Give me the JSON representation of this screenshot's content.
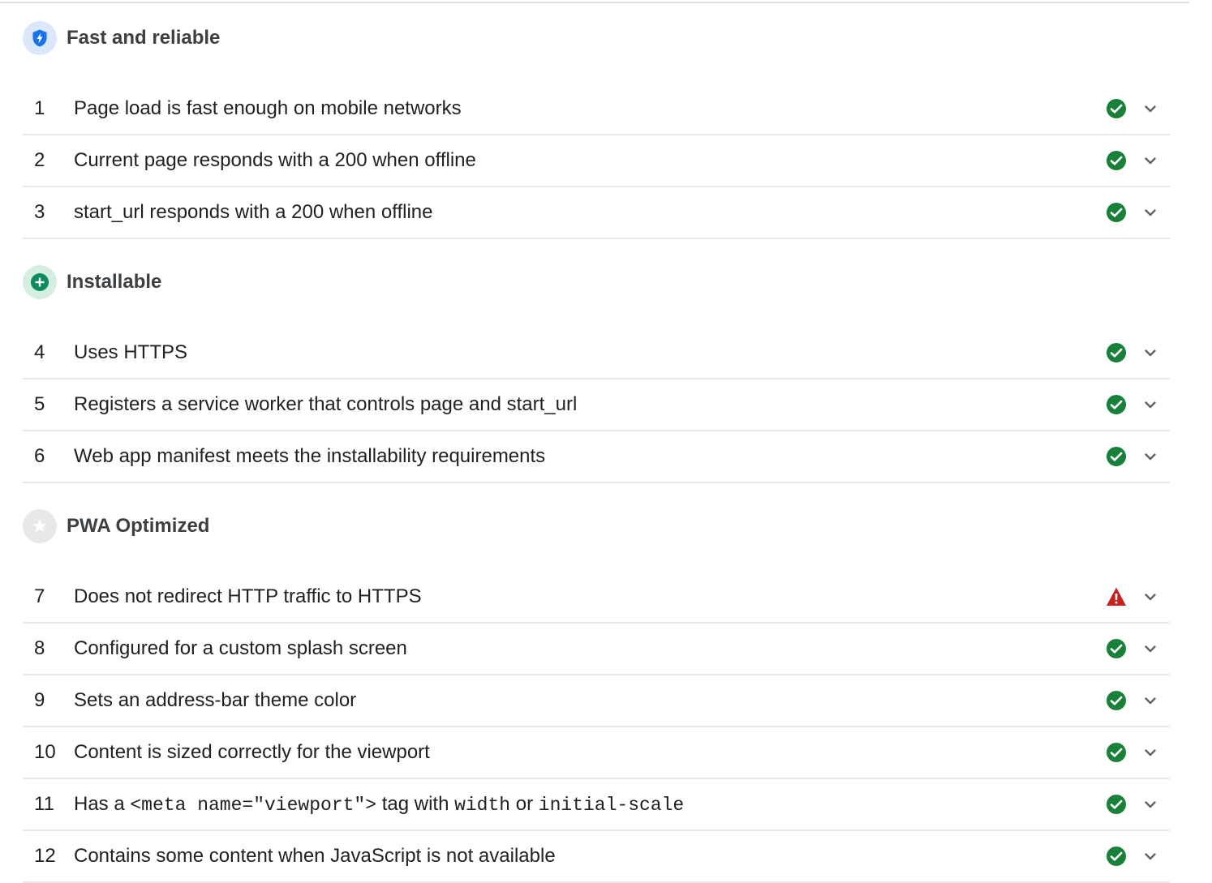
{
  "groups": [
    {
      "title": "Fast and reliable",
      "icon": "lightning-shield-icon",
      "icon_bg": "#dbe7fb",
      "icon_fg": "#1a73e8",
      "audits": [
        {
          "index": "1",
          "title": "Page load is fast enough on mobile networks",
          "status": "pass"
        },
        {
          "index": "2",
          "title": "Current page responds with a 200 when offline",
          "status": "pass"
        },
        {
          "index": "3",
          "title": "start_url responds with a 200 when offline",
          "status": "pass"
        }
      ]
    },
    {
      "title": "Installable",
      "icon": "plus-circle-icon",
      "icon_bg": "#d4eee0",
      "icon_fg": "#0d8a5f",
      "audits": [
        {
          "index": "4",
          "title": "Uses HTTPS",
          "status": "pass"
        },
        {
          "index": "5",
          "title": "Registers a service worker that controls page and start_url",
          "status": "pass"
        },
        {
          "index": "6",
          "title": "Web app manifest meets the installability requirements",
          "status": "pass"
        }
      ]
    },
    {
      "title": "PWA Optimized",
      "icon": "star-circle-icon",
      "icon_bg": "#e8e8e8",
      "icon_fg": "#ffffff",
      "audits": [
        {
          "index": "7",
          "title": "Does not redirect HTTP traffic to HTTPS",
          "status": "fail"
        },
        {
          "index": "8",
          "title": "Configured for a custom splash screen",
          "status": "pass"
        },
        {
          "index": "9",
          "title": "Sets an address-bar theme color",
          "status": "pass"
        },
        {
          "index": "10",
          "title": "Content is sized correctly for the viewport",
          "status": "pass"
        },
        {
          "index": "11",
          "title_parts": [
            {
              "text": "Has a ",
              "code": false
            },
            {
              "text": "<meta name=\"viewport\">",
              "code": true
            },
            {
              "text": " tag with ",
              "code": false
            },
            {
              "text": "width",
              "code": true
            },
            {
              "text": " or ",
              "code": false
            },
            {
              "text": "initial-scale",
              "code": true
            }
          ],
          "status": "pass"
        },
        {
          "index": "12",
          "title": "Contains some content when JavaScript is not available",
          "status": "pass"
        }
      ]
    }
  ],
  "icons": {
    "pass": "check-circle-icon",
    "fail": "warning-triangle-icon",
    "expand": "chevron-down-icon"
  },
  "colors": {
    "pass": "#188038",
    "fail": "#c5221f",
    "chevron": "#5f6368",
    "divider": "#e8e8e8"
  }
}
